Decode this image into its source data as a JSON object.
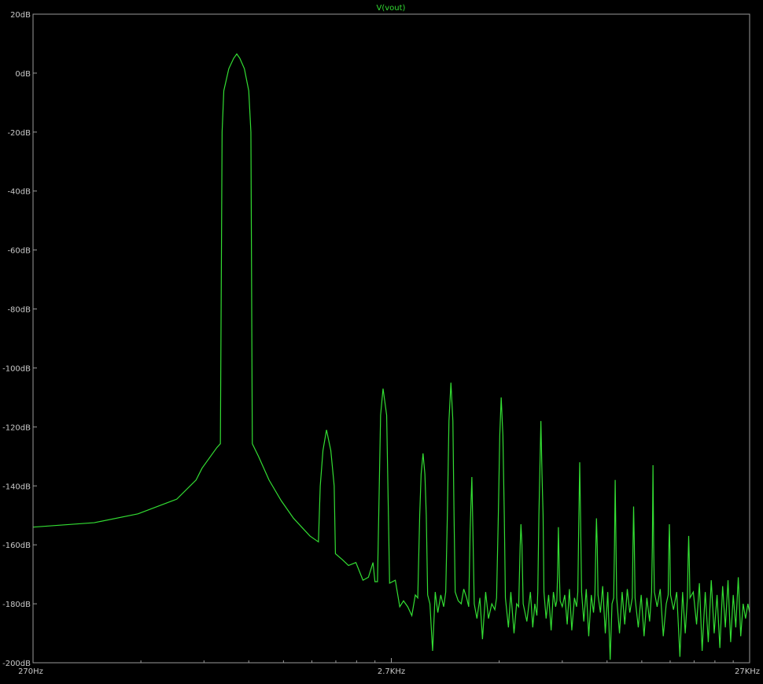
{
  "chart_data": {
    "type": "line",
    "title": "V(vout)",
    "xlabel": "",
    "ylabel": "",
    "x_scale": "log",
    "xlim": [
      270,
      27000
    ],
    "ylim": [
      -200,
      20
    ],
    "x_ticks": [
      {
        "value": 270,
        "label": "270Hz"
      },
      {
        "value": 2700,
        "label": "2.7KHz"
      },
      {
        "value": 27000,
        "label": "27KHz"
      }
    ],
    "y_ticks": [
      {
        "value": 20,
        "label": "20dB"
      },
      {
        "value": 0,
        "label": "0dB"
      },
      {
        "value": -20,
        "label": "-20dB"
      },
      {
        "value": -40,
        "label": "-40dB"
      },
      {
        "value": -60,
        "label": "-60dB"
      },
      {
        "value": -80,
        "label": "-80dB"
      },
      {
        "value": -100,
        "label": "-100dB"
      },
      {
        "value": -120,
        "label": "-120dB"
      },
      {
        "value": -140,
        "label": "-140dB"
      },
      {
        "value": -160,
        "label": "-160dB"
      },
      {
        "value": -180,
        "label": "-180dB"
      },
      {
        "value": -200,
        "label": "-200dB"
      }
    ],
    "grid": false,
    "series": [
      {
        "name": "V(vout)",
        "color": "#33dd33",
        "points": [
          [
            270,
            -154
          ],
          [
            400,
            -152.5
          ],
          [
            530,
            -149.5
          ],
          [
            680,
            -144.5
          ],
          [
            770,
            -138
          ],
          [
            800,
            -134
          ],
          [
            880,
            -127
          ],
          [
            900,
            -125.7
          ],
          [
            910,
            -20
          ],
          [
            920,
            -6
          ],
          [
            950,
            1.5
          ],
          [
            980,
            5
          ],
          [
            1000,
            6.5
          ],
          [
            1020,
            5
          ],
          [
            1050,
            1.5
          ],
          [
            1080,
            -6
          ],
          [
            1095,
            -20
          ],
          [
            1105,
            -125.7
          ],
          [
            1150,
            -130
          ],
          [
            1230,
            -138
          ],
          [
            1330,
            -145
          ],
          [
            1440,
            -151
          ],
          [
            1600,
            -157
          ],
          [
            1690,
            -159
          ],
          [
            1710,
            -140
          ],
          [
            1740,
            -128
          ],
          [
            1780,
            -121
          ],
          [
            1830,
            -128
          ],
          [
            1870,
            -140
          ],
          [
            1885,
            -163
          ],
          [
            1970,
            -165
          ],
          [
            2050,
            -167
          ],
          [
            2150,
            -166
          ],
          [
            2250,
            -172
          ],
          [
            2330,
            -171
          ],
          [
            2400,
            -166
          ],
          [
            2430,
            -172.5
          ],
          [
            2470,
            -172.5
          ],
          [
            2490,
            -150
          ],
          [
            2520,
            -116
          ],
          [
            2560,
            -107
          ],
          [
            2620,
            -116
          ],
          [
            2650,
            -150
          ],
          [
            2670,
            -173
          ],
          [
            2770,
            -172
          ],
          [
            2850,
            -181
          ],
          [
            2920,
            -179
          ],
          [
            3000,
            -181
          ],
          [
            3080,
            -184
          ],
          [
            3150,
            -177
          ],
          [
            3200,
            -178
          ],
          [
            3240,
            -150
          ],
          [
            3270,
            -136
          ],
          [
            3310,
            -129
          ],
          [
            3350,
            -136
          ],
          [
            3380,
            -150
          ],
          [
            3410,
            -177
          ],
          [
            3460,
            -180
          ],
          [
            3520,
            -196
          ],
          [
            3580,
            -176
          ],
          [
            3640,
            -183
          ],
          [
            3710,
            -177
          ],
          [
            3780,
            -181
          ],
          [
            3830,
            -176
          ],
          [
            3870,
            -150
          ],
          [
            3910,
            -118
          ],
          [
            3960,
            -105
          ],
          [
            4010,
            -118
          ],
          [
            4040,
            -150
          ],
          [
            4070,
            -176
          ],
          [
            4150,
            -179
          ],
          [
            4230,
            -180
          ],
          [
            4300,
            -175
          ],
          [
            4380,
            -178
          ],
          [
            4440,
            -181
          ],
          [
            4480,
            -155
          ],
          [
            4530,
            -137
          ],
          [
            4560,
            -155
          ],
          [
            4600,
            -180
          ],
          [
            4680,
            -185
          ],
          [
            4770,
            -178
          ],
          [
            4850,
            -192
          ],
          [
            4950,
            -176
          ],
          [
            5040,
            -185
          ],
          [
            5150,
            -180
          ],
          [
            5250,
            -182
          ],
          [
            5310,
            -178
          ],
          [
            5370,
            -150
          ],
          [
            5420,
            -123
          ],
          [
            5470,
            -110
          ],
          [
            5530,
            -123
          ],
          [
            5580,
            -150
          ],
          [
            5620,
            -178
          ],
          [
            5730,
            -188
          ],
          [
            5820,
            -176
          ],
          [
            5940,
            -190
          ],
          [
            6040,
            -180
          ],
          [
            6120,
            -181
          ],
          [
            6180,
            -160
          ],
          [
            6210,
            -153
          ],
          [
            6250,
            -160
          ],
          [
            6300,
            -180
          ],
          [
            6450,
            -186
          ],
          [
            6600,
            -176
          ],
          [
            6700,
            -188
          ],
          [
            6790,
            -180
          ],
          [
            6880,
            -184
          ],
          [
            6920,
            -176
          ],
          [
            6970,
            -150
          ],
          [
            7010,
            -136
          ],
          [
            7060,
            -118
          ],
          [
            7110,
            -136
          ],
          [
            7160,
            -150
          ],
          [
            7200,
            -176
          ],
          [
            7300,
            -185
          ],
          [
            7420,
            -177
          ],
          [
            7540,
            -189
          ],
          [
            7650,
            -176
          ],
          [
            7760,
            -181
          ],
          [
            7820,
            -179
          ],
          [
            7860,
            -170
          ],
          [
            7900,
            -154
          ],
          [
            7950,
            -170
          ],
          [
            7990,
            -179
          ],
          [
            8100,
            -181
          ],
          [
            8230,
            -177
          ],
          [
            8360,
            -187
          ],
          [
            8480,
            -175
          ],
          [
            8610,
            -189
          ],
          [
            8760,
            -178
          ],
          [
            8880,
            -181
          ],
          [
            8950,
            -176
          ],
          [
            9000,
            -155
          ],
          [
            9060,
            -132
          ],
          [
            9120,
            -155
          ],
          [
            9170,
            -176
          ],
          [
            9300,
            -186
          ],
          [
            9450,
            -175
          ],
          [
            9600,
            -191
          ],
          [
            9760,
            -177
          ],
          [
            9900,
            -183
          ],
          [
            9990,
            -177
          ],
          [
            10050,
            -160
          ],
          [
            10090,
            -151
          ],
          [
            10140,
            -160
          ],
          [
            10190,
            -177
          ],
          [
            10350,
            -183
          ],
          [
            10500,
            -174
          ],
          [
            10680,
            -190
          ],
          [
            10850,
            -176
          ],
          [
            11020,
            -199
          ],
          [
            11150,
            -180
          ],
          [
            11270,
            -178
          ],
          [
            11330,
            -160
          ],
          [
            11380,
            -138
          ],
          [
            11440,
            -160
          ],
          [
            11490,
            -178
          ],
          [
            11700,
            -190
          ],
          [
            11900,
            -176
          ],
          [
            12100,
            -187
          ],
          [
            12300,
            -175
          ],
          [
            12500,
            -183
          ],
          [
            12700,
            -178
          ],
          [
            12760,
            -160
          ],
          [
            12810,
            -147
          ],
          [
            12870,
            -160
          ],
          [
            12930,
            -178
          ],
          [
            13200,
            -188
          ],
          [
            13450,
            -177
          ],
          [
            13700,
            -191
          ],
          [
            13950,
            -178
          ],
          [
            14200,
            -186
          ],
          [
            14380,
            -176
          ],
          [
            14450,
            -160
          ],
          [
            14510,
            -133
          ],
          [
            14570,
            -160
          ],
          [
            14640,
            -176
          ],
          [
            14900,
            -181
          ],
          [
            15200,
            -175
          ],
          [
            15500,
            -191
          ],
          [
            15800,
            -180
          ],
          [
            16000,
            -177
          ],
          [
            16060,
            -162
          ],
          [
            16120,
            -153
          ],
          [
            16180,
            -162
          ],
          [
            16240,
            -177
          ],
          [
            16550,
            -182
          ],
          [
            16900,
            -176
          ],
          [
            17250,
            -198
          ],
          [
            17550,
            -176
          ],
          [
            17850,
            -190
          ],
          [
            18100,
            -178
          ],
          [
            18180,
            -165
          ],
          [
            18250,
            -157
          ],
          [
            18320,
            -165
          ],
          [
            18400,
            -178
          ],
          [
            18800,
            -176
          ],
          [
            19200,
            -187
          ],
          [
            19550,
            -173
          ],
          [
            19900,
            -196
          ],
          [
            20300,
            -176
          ],
          [
            20700,
            -193
          ],
          [
            21100,
            -172
          ],
          [
            21500,
            -190
          ],
          [
            21900,
            -177
          ],
          [
            22300,
            -195
          ],
          [
            22700,
            -174
          ],
          [
            23100,
            -188
          ],
          [
            23500,
            -172
          ],
          [
            23900,
            -193
          ],
          [
            24300,
            -177
          ],
          [
            24700,
            -188
          ],
          [
            25100,
            -171
          ],
          [
            25500,
            -191
          ],
          [
            25900,
            -180
          ],
          [
            26300,
            -185
          ],
          [
            26700,
            -180
          ],
          [
            27000,
            -183
          ]
        ]
      }
    ]
  }
}
